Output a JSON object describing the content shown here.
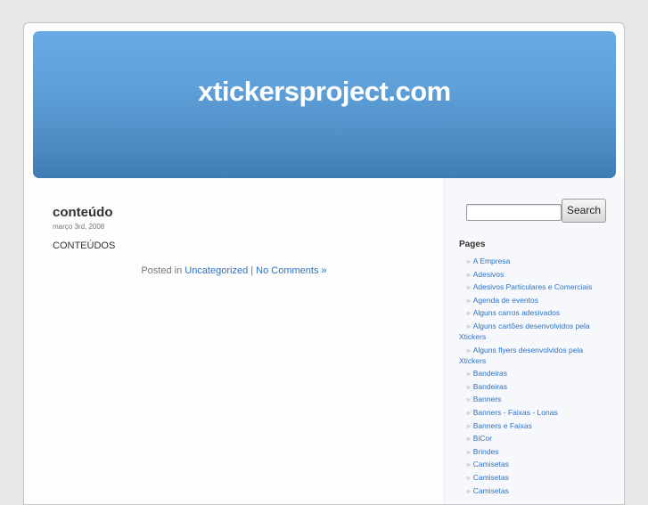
{
  "header": {
    "blog_title": "xtickersproject.com"
  },
  "post": {
    "title": "conteúdo",
    "date": "março 3rd, 2008",
    "body": "CONTEÚDOS",
    "meta_prefix": "Posted in ",
    "category": "Uncategorized",
    "separator": " | ",
    "comments": "No Comments »"
  },
  "sidebar": {
    "search": {
      "value": "",
      "button_label": "Search"
    },
    "pages_heading": "Pages",
    "bullet": "»",
    "pages": [
      "A Empresa",
      "Adesivos",
      "Adesivos Particulares e Comerciais",
      "Agenda de eventos",
      "Alguns carros adesivados",
      "Alguns cartões desenvolvidos pela Xtickers",
      "Alguns flyers desenvolvidos pela Xtickers",
      "Bandeiras",
      "Bandeiras",
      "Banners",
      "Banners - Faixas - Lonas",
      "Banners e Faixas",
      "BiCor",
      "Brindes",
      "Camisetas",
      "Camisetas",
      "Camisetas"
    ]
  },
  "colors": {
    "header_top": "#69aae5",
    "header_bottom": "#3f7bb4",
    "link": "#2d72c4",
    "sidebar_bg": "#f6f8fb"
  }
}
